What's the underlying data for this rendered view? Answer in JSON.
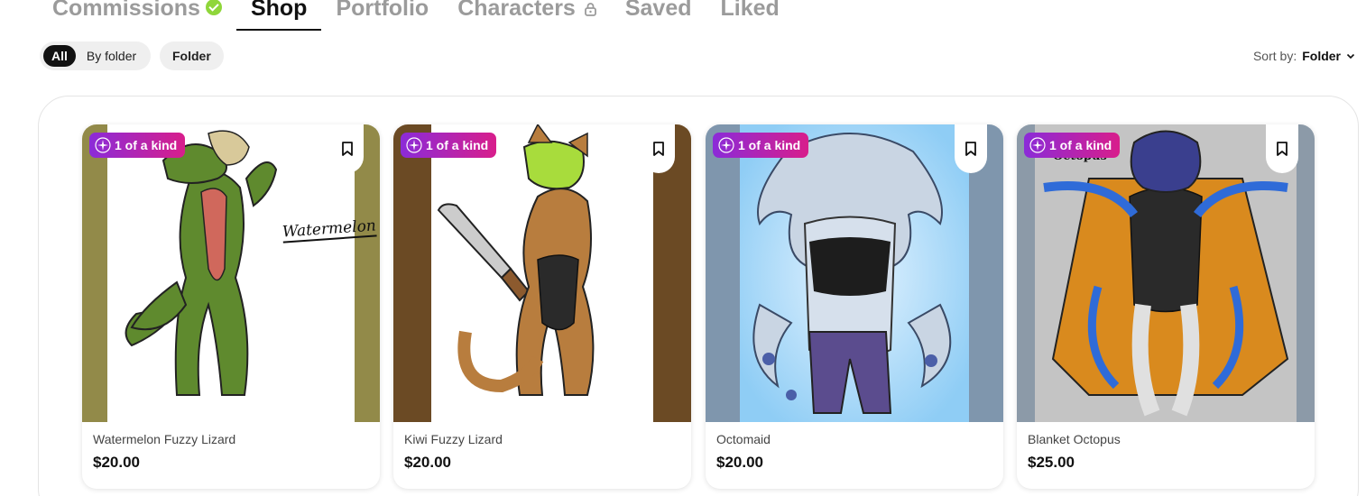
{
  "tabs": [
    {
      "label": "Commissions"
    },
    {
      "label": "Shop"
    },
    {
      "label": "Portfolio"
    },
    {
      "label": "Characters"
    },
    {
      "label": "Saved"
    },
    {
      "label": "Liked"
    }
  ],
  "filters": {
    "all": "All",
    "by_folder": "By folder",
    "folder": "Folder"
  },
  "sort": {
    "label": "Sort by:",
    "value": "Folder"
  },
  "badge_text": "1 of a kind",
  "items": [
    {
      "title": "Watermelon Fuzzy Lizard",
      "price": "$20.00",
      "art_text": "Watermelon"
    },
    {
      "title": "Kiwi Fuzzy Lizard",
      "price": "$20.00"
    },
    {
      "title": "Octomaid",
      "price": "$20.00"
    },
    {
      "title": "Blanket Octopus",
      "price": "$25.00",
      "art_text": "Octopus"
    }
  ],
  "colors": {
    "accent_start": "#8b2bd8",
    "accent_end": "#d81e8b",
    "verified": "#8fd63a"
  }
}
